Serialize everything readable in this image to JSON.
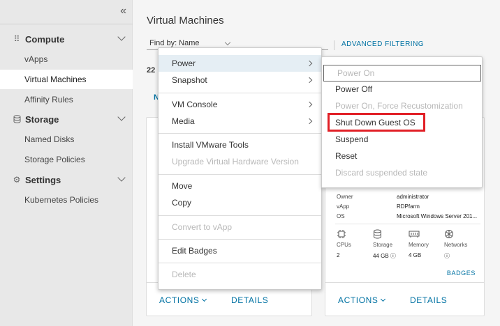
{
  "sidebar": {
    "collapse_icon": "«",
    "sections": [
      {
        "label": "Compute",
        "icon": "compute-icon"
      },
      {
        "label": "Storage",
        "icon": "storage-icon"
      },
      {
        "label": "Settings",
        "icon": "settings-icon"
      }
    ],
    "items": [
      {
        "label": "vApps"
      },
      {
        "label": "Virtual Machines"
      },
      {
        "label": "Affinity Rules"
      },
      {
        "label": "Named Disks"
      },
      {
        "label": "Storage Policies"
      },
      {
        "label": "Kubernetes Policies"
      }
    ]
  },
  "main": {
    "title": "Virtual Machines",
    "find_by": "Find by:  Name",
    "advanced_filtering": "ADVANCED FILTERING",
    "count": "22",
    "n_letter": "N"
  },
  "context_menu": {
    "items": [
      {
        "label": "Power"
      },
      {
        "label": "Snapshot"
      },
      {
        "label": "VM Console"
      },
      {
        "label": "Media"
      },
      {
        "label": "Install VMware Tools"
      },
      {
        "label": "Upgrade Virtual Hardware Version"
      },
      {
        "label": "Move"
      },
      {
        "label": "Copy"
      },
      {
        "label": "Convert to vApp"
      },
      {
        "label": "Edit Badges"
      },
      {
        "label": "Delete"
      }
    ]
  },
  "power_submenu": {
    "items": [
      {
        "label": "Power On"
      },
      {
        "label": "Power Off"
      },
      {
        "label": "Power On, Force Recustomization"
      },
      {
        "label": "Shut Down Guest OS"
      },
      {
        "label": "Suspend"
      },
      {
        "label": "Reset"
      },
      {
        "label": "Discard suspended state"
      }
    ]
  },
  "vm_card": {
    "owner_label": "Owner",
    "owner_value": "administrator",
    "vapp_label": "vApp",
    "vapp_value": "RDPfarm",
    "os_label": "OS",
    "os_value": "Microsoft Windows Server 201...",
    "resources": [
      {
        "label": "CPUs",
        "value": "2"
      },
      {
        "label": "Storage",
        "value": "44 GB"
      },
      {
        "label": "Memory",
        "value": "4 GB"
      },
      {
        "label": "Networks",
        "value": ""
      }
    ],
    "badges": "BADGES",
    "info_icon": "ⓘ"
  },
  "card_footer": {
    "actions": "ACTIONS",
    "details": "DETAILS"
  },
  "colors": {
    "link": "#0072a3",
    "highlight_box": "#e11f26"
  }
}
